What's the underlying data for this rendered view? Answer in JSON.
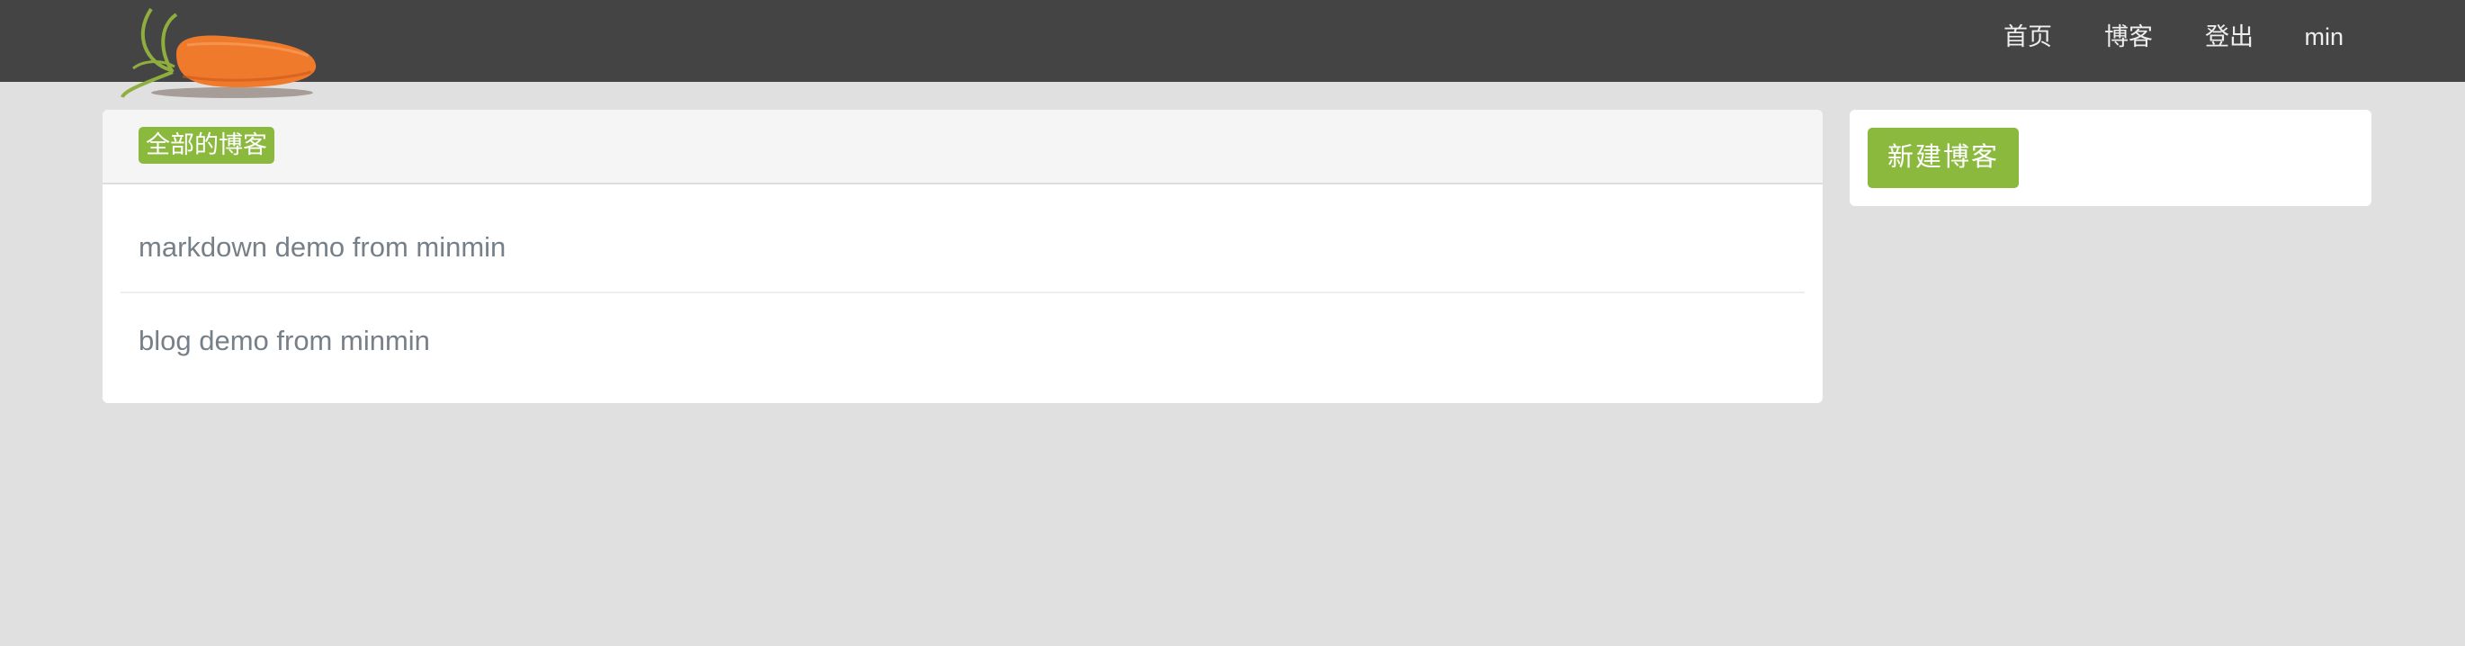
{
  "navbar": {
    "logo_icon": "carrot-icon",
    "links": [
      "首页",
      "博客",
      "登出"
    ],
    "user": "min"
  },
  "main": {
    "header_label": "全部的博客",
    "blogs": [
      {
        "title": "markdown demo from minmin"
      },
      {
        "title": "blog demo from minmin"
      }
    ]
  },
  "sidebar": {
    "new_blog_button": "新建博客"
  },
  "colors": {
    "navbar_bg": "#444444",
    "page_bg": "#e0e0e0",
    "accent_green": "#8ab93e",
    "carrot_orange": "#f07a2c",
    "link_text": "#778088"
  }
}
